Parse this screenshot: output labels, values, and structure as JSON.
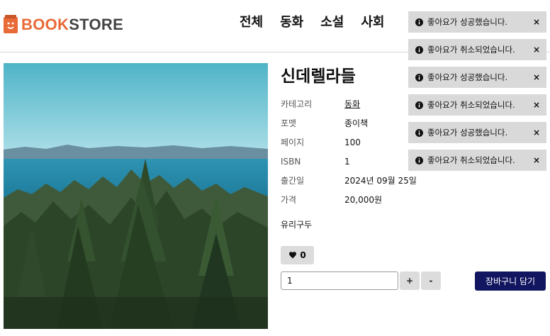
{
  "header": {
    "logo": {
      "part1": "BOOK",
      "part2": "STORE",
      "icon": "book-icon"
    },
    "nav": [
      {
        "label": "전체"
      },
      {
        "label": "동화"
      },
      {
        "label": "소설"
      },
      {
        "label": "사회"
      }
    ]
  },
  "book": {
    "title": "신데렐라들",
    "details": [
      {
        "label": "카테고리",
        "value": "동화"
      },
      {
        "label": "포맷",
        "value": "종이책"
      },
      {
        "label": "페이지",
        "value": "100"
      },
      {
        "label": "ISBN",
        "value": "1"
      },
      {
        "label": "출간일",
        "value": "2024년 09월 25일"
      },
      {
        "label": "가격",
        "value": "20,000원"
      }
    ],
    "summary": "유리구두",
    "likes": "0",
    "quantity": "1"
  },
  "buttons": {
    "plus": "+",
    "minus": "-",
    "cart": "장바구니 담기"
  },
  "toasts": [
    {
      "message": "좋아요가 성공했습니다.",
      "close": "×"
    },
    {
      "message": "좋아요가 취소되었습니다.",
      "close": "×"
    },
    {
      "message": "좋아요가 성공했습니다.",
      "close": "×"
    },
    {
      "message": "좋아요가 취소되었습니다.",
      "close": "×"
    },
    {
      "message": "좋아요가 성공했습니다.",
      "close": "×"
    },
    {
      "message": "좋아요가 취소되었습니다.",
      "close": "×"
    }
  ],
  "colors": {
    "brand_orange": "#e86a36",
    "cart_button": "#121660",
    "toast_bg": "#d9d9d9"
  }
}
